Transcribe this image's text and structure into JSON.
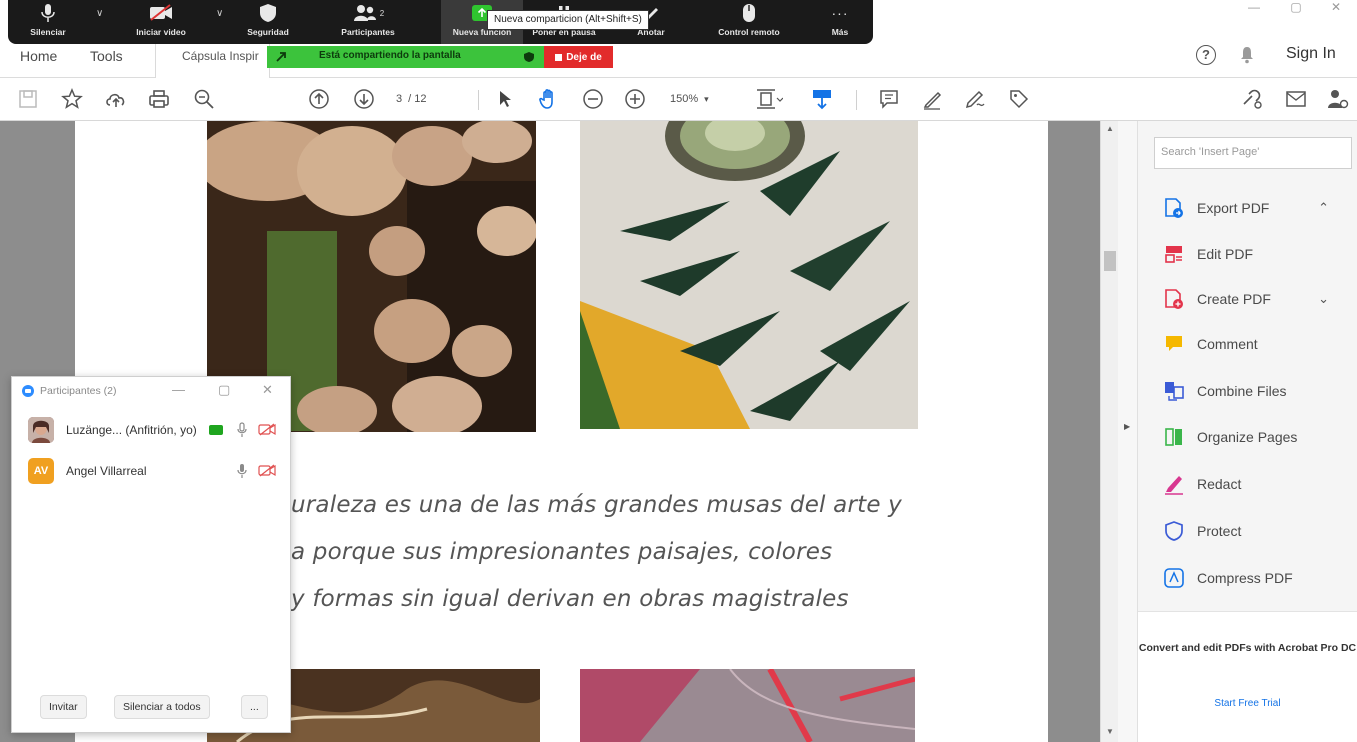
{
  "window": {
    "minimize": "—",
    "maximize": "▢",
    "close": "✕"
  },
  "menu": {
    "home": "Home",
    "tools": "Tools",
    "doc_tab": "Cápsula Inspir",
    "sign_in": "Sign In"
  },
  "toolbar": {
    "page_current": "3",
    "page_total": "/ 12",
    "zoom": "150%"
  },
  "zoom_meeting": {
    "buttons": [
      {
        "label": "Silenciar",
        "icon": "microphone-icon"
      },
      {
        "label": "Iniciar video",
        "icon": "video-off-icon"
      },
      {
        "label": "Seguridad",
        "icon": "shield-icon"
      },
      {
        "label": "Participantes",
        "icon": "participants-icon",
        "count": "2"
      },
      {
        "label": "Nueva función",
        "icon": "share-screen-icon"
      },
      {
        "label": "Poner en pausa",
        "icon": "pause-icon"
      },
      {
        "label": "Anotar",
        "icon": "annotate-icon"
      },
      {
        "label": "Control remoto",
        "icon": "mouse-icon"
      },
      {
        "label": "Más",
        "icon": "more-icon"
      }
    ],
    "tooltip": "Nueva comparticion (Alt+Shift+S)",
    "share_status": "Está compartiendo la pantalla",
    "stop_share": "Deje de",
    "accent_green": "#3cc33c",
    "stop_red": "#e22b2b"
  },
  "document": {
    "lines": [
      "uraleza es una de las más grandes musas del arte y",
      "a porque sus impresionantes paisajes, colores",
      "y formas sin igual derivan en obras magistrales"
    ]
  },
  "right_pane": {
    "search_placeholder": "Search 'Insert Page'",
    "tools": [
      {
        "label": "Export PDF",
        "icon": "export-pdf-icon",
        "color": "#1473e6"
      },
      {
        "label": "Edit PDF",
        "icon": "edit-pdf-icon",
        "color": "#e3344b"
      },
      {
        "label": "Create PDF",
        "icon": "create-pdf-icon",
        "color": "#e3344b"
      },
      {
        "label": "Comment",
        "icon": "comment-icon",
        "color": "#f5b800"
      },
      {
        "label": "Combine Files",
        "icon": "combine-files-icon",
        "color": "#3b5bd6"
      },
      {
        "label": "Organize Pages",
        "icon": "organize-pages-icon",
        "color": "#3ab54a"
      },
      {
        "label": "Redact",
        "icon": "redact-icon",
        "color": "#d83790"
      },
      {
        "label": "Protect",
        "icon": "protect-icon",
        "color": "#3b5bd6"
      },
      {
        "label": "Compress PDF",
        "icon": "compress-pdf-icon",
        "color": "#1473e6"
      }
    ],
    "promo_text": "Convert and edit PDFs with Acrobat Pro DC",
    "promo_link": "Start Free Trial"
  },
  "participants_panel": {
    "title": "Participantes (2)",
    "people": [
      {
        "name": "Luzänge... (Anfitrión, yo)",
        "initials": "",
        "avatar_color": "#8a5a5a"
      },
      {
        "name": "Angel Villarreal",
        "initials": "AV",
        "avatar_color": "#f0a020"
      }
    ],
    "invite": "Invitar",
    "mute_all": "Silenciar a todos",
    "more": "..."
  }
}
